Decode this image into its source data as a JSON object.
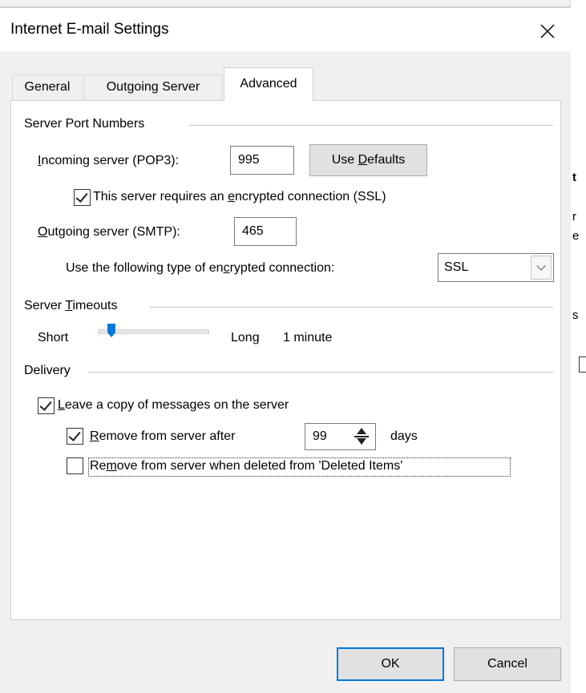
{
  "dialog": {
    "title": "Internet E-mail Settings",
    "close_icon": "close-icon"
  },
  "tabs": [
    {
      "label": "General",
      "active": false
    },
    {
      "label": "Outgoing Server",
      "active": false
    },
    {
      "label": "Advanced",
      "active": true
    }
  ],
  "server_ports": {
    "section_label": "Server Port Numbers",
    "incoming": {
      "label_underlined": "I",
      "label_rest": "ncoming server (POP3):",
      "value": "995"
    },
    "use_defaults": {
      "pre": "Use ",
      "underlined": "D",
      "post": "efaults"
    },
    "ssl_checkbox": {
      "checked": true,
      "pre": "This server requires an ",
      "underlined": "e",
      "post": "ncrypted connection (SSL)"
    },
    "outgoing": {
      "label_underlined": "O",
      "label_rest": "utgoing server (SMTP):",
      "value": "465"
    },
    "encryption": {
      "label_pre": "Use the following type of en",
      "label_underlined": "c",
      "label_post": "rypted connection:",
      "value": "SSL"
    }
  },
  "timeouts": {
    "section_pre": "Server ",
    "section_underlined": "T",
    "section_post": "imeouts",
    "short_label": "Short",
    "long_label": "Long",
    "value_label": "1 minute",
    "slider_level": 0.1
  },
  "delivery": {
    "section_label": "Delivery",
    "leave_copy": {
      "checked": true,
      "underlined": "L",
      "rest": "eave a copy of messages on the server"
    },
    "remove_after": {
      "checked": true,
      "underlined": "R",
      "rest": "emove from server after",
      "days_value": "99",
      "days_label": "days"
    },
    "remove_deleted": {
      "checked": false,
      "pre": "Re",
      "underlined": "m",
      "post": "ove from server when deleted from 'Deleted Items'"
    }
  },
  "footer": {
    "ok_label": "OK",
    "cancel_label": "Cancel"
  },
  "background_window": {
    "fragments": [
      "t",
      "r",
      "e",
      "s"
    ]
  },
  "colors": {
    "accent": "#0078d7",
    "panel_bg": "#ffffff",
    "dialog_bg": "#f0f0f0"
  }
}
